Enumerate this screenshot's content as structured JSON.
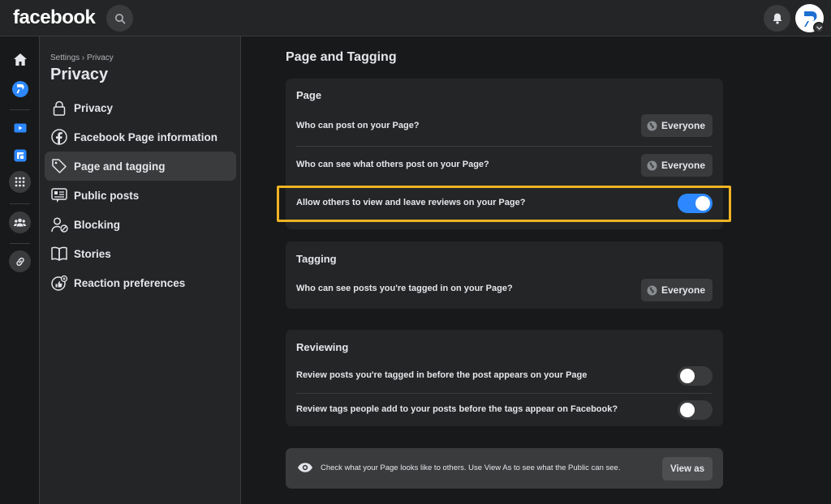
{
  "header": {
    "logo": "facebook"
  },
  "sidebar": {
    "breadcrumb": "Settings › Privacy",
    "title": "Privacy",
    "items": [
      {
        "label": "Privacy",
        "icon": "lock-icon",
        "active": false
      },
      {
        "label": "Facebook Page information",
        "icon": "facebook-icon",
        "active": false
      },
      {
        "label": "Page and tagging",
        "icon": "tag-icon",
        "active": true
      },
      {
        "label": "Public posts",
        "icon": "news-icon",
        "active": false
      },
      {
        "label": "Blocking",
        "icon": "blocking-icon",
        "active": false
      },
      {
        "label": "Stories",
        "icon": "book-icon",
        "active": false
      },
      {
        "label": "Reaction preferences",
        "icon": "reaction-icon",
        "active": false
      }
    ]
  },
  "main": {
    "heading": "Page and Tagging",
    "page_card": {
      "title": "Page",
      "rows": [
        {
          "label": "Who can post on your Page?",
          "value": "Everyone"
        },
        {
          "label": "Who can see what others post on your Page?",
          "value": "Everyone"
        },
        {
          "label": "Allow others to view and leave reviews on your Page?",
          "toggle": true
        }
      ]
    },
    "tagging_card": {
      "title": "Tagging",
      "rows": [
        {
          "label": "Who can see posts you're tagged in on your Page?",
          "value": "Everyone"
        }
      ]
    },
    "reviewing_card": {
      "title": "Reviewing",
      "rows": [
        {
          "label": "Review posts you're tagged in before the post appears on your Page",
          "toggle": false
        },
        {
          "label": "Review tags people add to your posts before the tags appear on Facebook?",
          "toggle": false
        }
      ]
    },
    "view_as": {
      "text": "Check what your Page looks like to others. Use View As to see what the Public can see.",
      "button": "View as"
    }
  },
  "colors": {
    "accent": "#2d88ff",
    "highlight": "#f0b323",
    "background": "#18191a",
    "card": "#242526"
  }
}
